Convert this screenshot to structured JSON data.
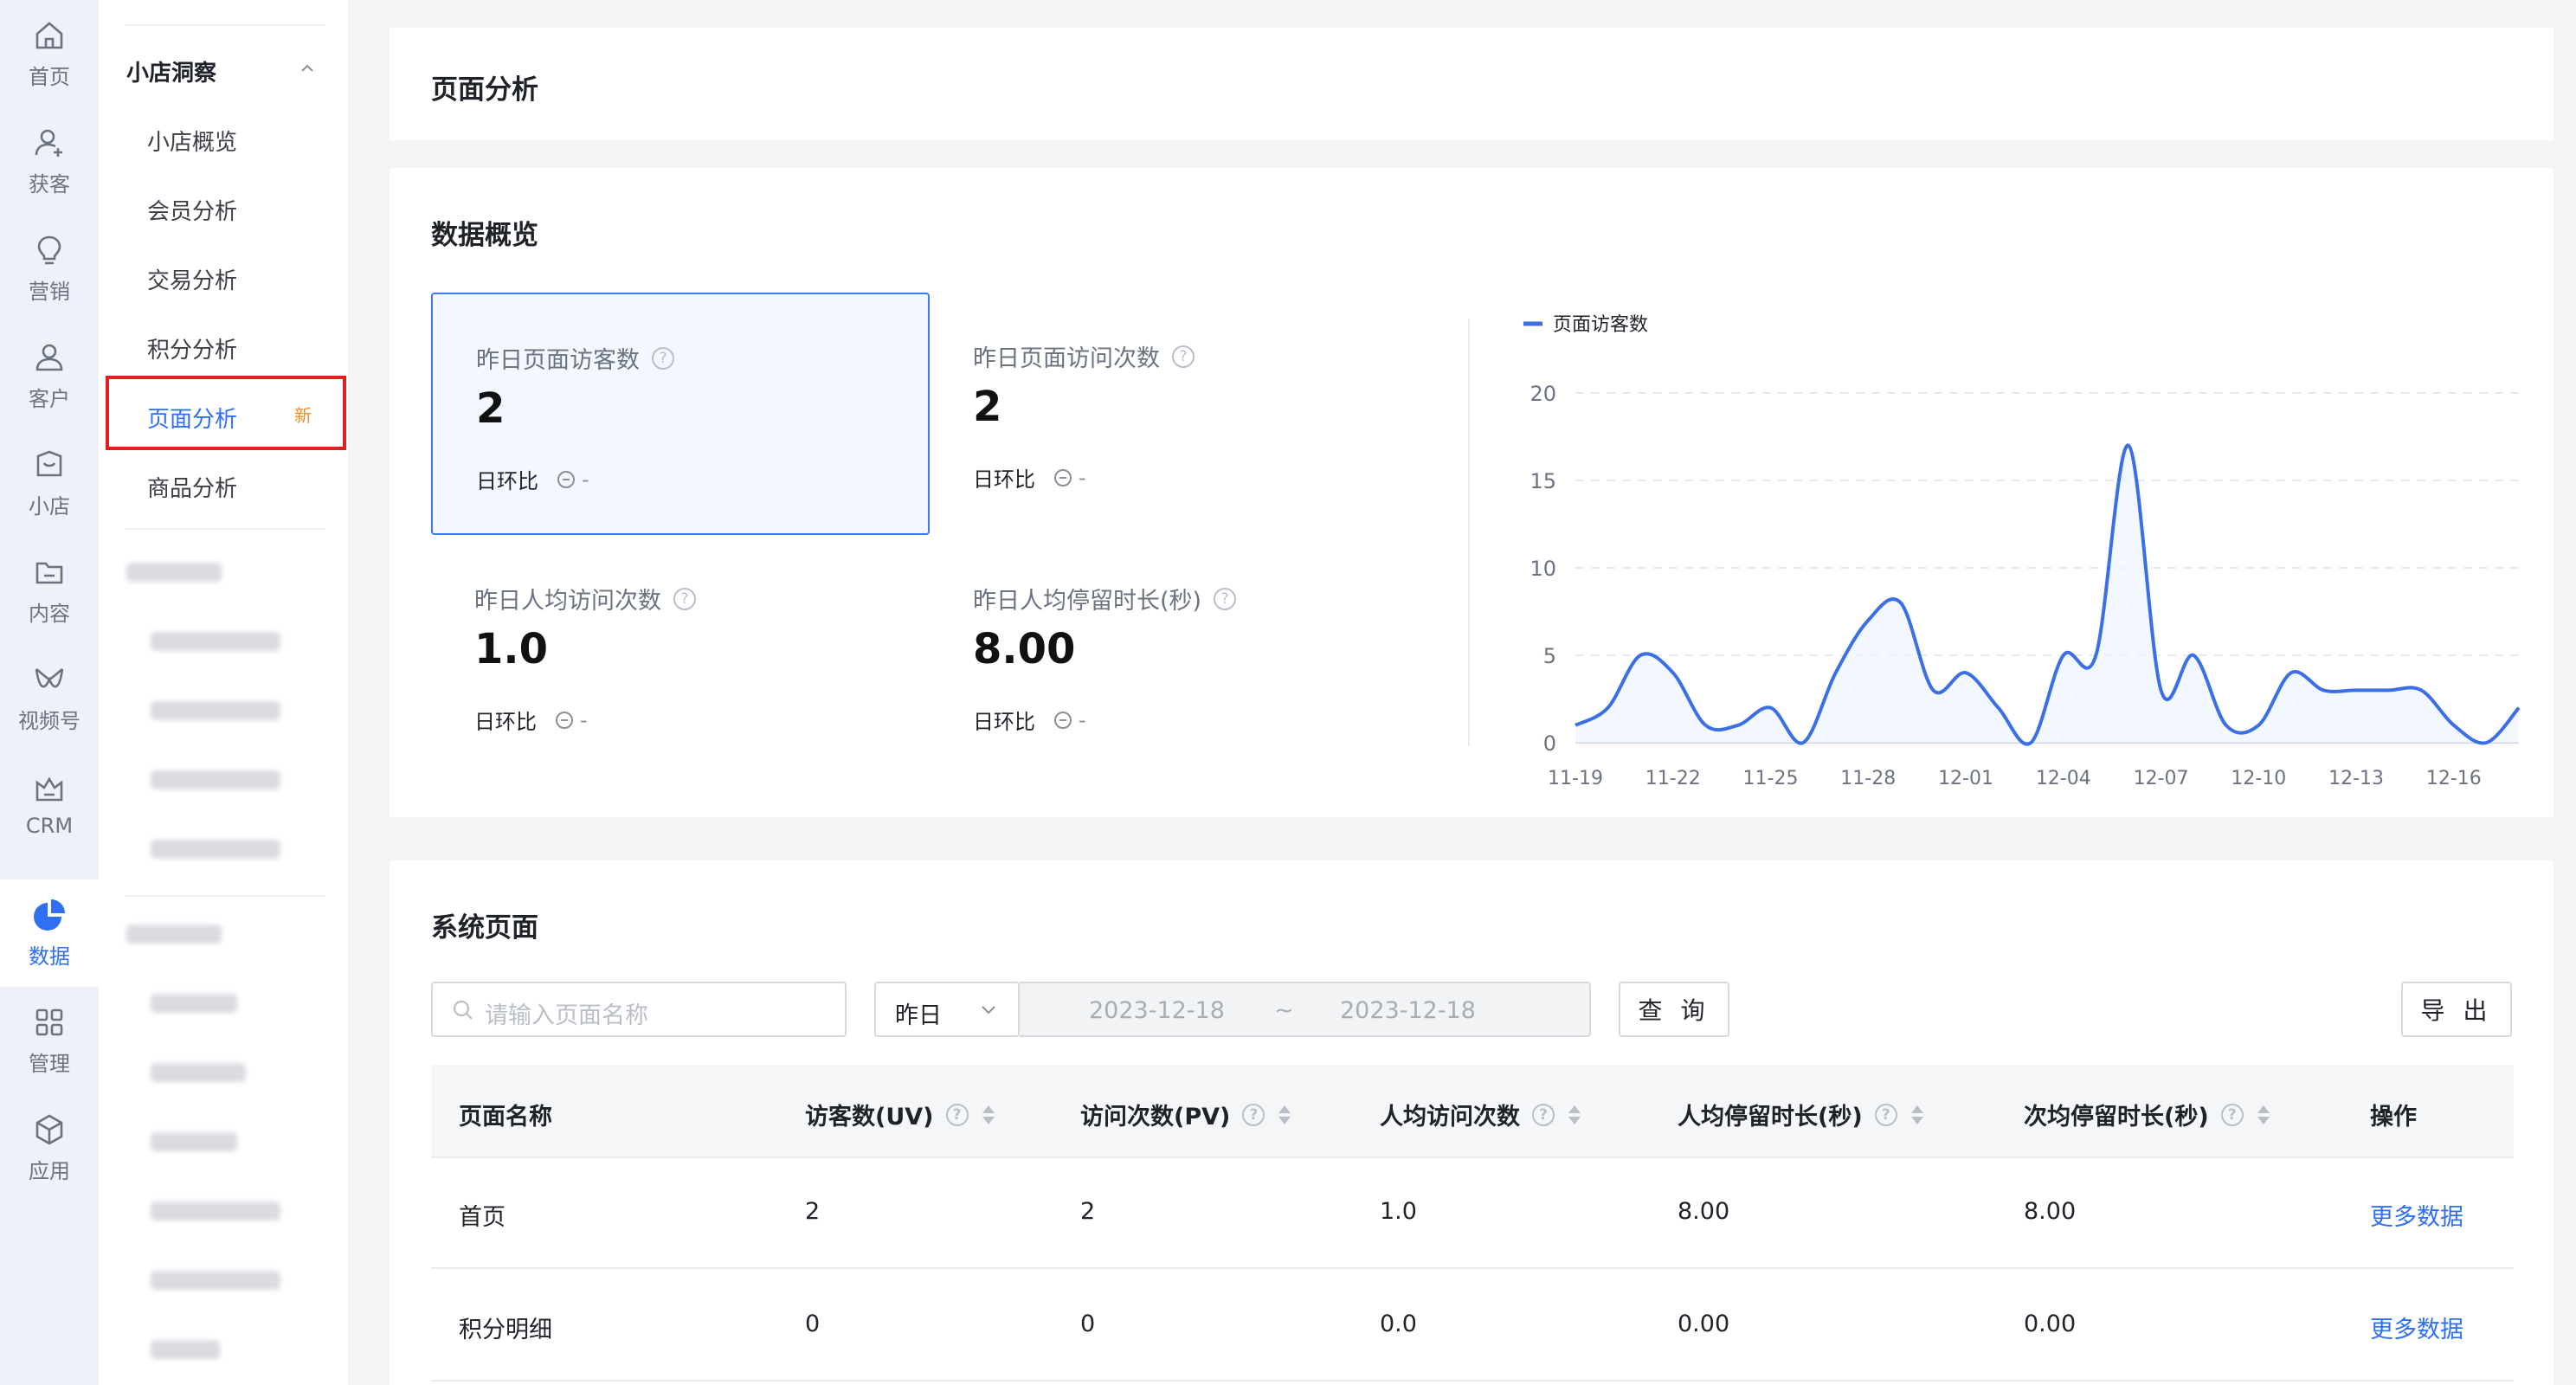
{
  "rail": {
    "items": [
      {
        "label": "首页",
        "icon": "home-icon"
      },
      {
        "label": "获客",
        "icon": "user-add-icon"
      },
      {
        "label": "营销",
        "icon": "bulb-icon"
      },
      {
        "label": "客户",
        "icon": "user-icon"
      },
      {
        "label": "小店",
        "icon": "shop-icon"
      },
      {
        "label": "内容",
        "icon": "folder-icon"
      },
      {
        "label": "视频号",
        "icon": "video-channel-icon"
      },
      {
        "label": "CRM",
        "icon": "crm-icon"
      },
      {
        "label": "数据",
        "icon": "pie-chart-icon"
      },
      {
        "label": "管理",
        "icon": "grid-icon"
      },
      {
        "label": "应用",
        "icon": "cube-icon"
      }
    ],
    "active_index": 8,
    "active_color": "#2f6ff2"
  },
  "menu": {
    "group_title": "小店洞察",
    "items": [
      "小店概览",
      "会员分析",
      "交易分析",
      "积分分析",
      "页面分析",
      "商品分析"
    ],
    "active_item": "页面分析",
    "new_badge": "新",
    "highlight_color": "#e02020"
  },
  "page": {
    "title": "页面分析"
  },
  "overview": {
    "title": "数据概览",
    "stats": [
      {
        "label": "昨日页面访客数",
        "value": "2",
        "compare_label": "日环比",
        "compare_value": "-"
      },
      {
        "label": "昨日页面访问次数",
        "value": "2",
        "compare_label": "日环比",
        "compare_value": "-"
      },
      {
        "label": "昨日人均访问次数",
        "value": "1.0",
        "compare_label": "日环比",
        "compare_value": "-"
      },
      {
        "label": "昨日人均停留时长(秒)",
        "value": "8.00",
        "compare_label": "日环比",
        "compare_value": "-"
      }
    ],
    "help_glyph": "?"
  },
  "chart_data": {
    "type": "line",
    "legend": [
      "页面访客数"
    ],
    "legend_position": "top-left",
    "x": [
      "11-19",
      "11-20",
      "11-21",
      "11-22",
      "11-23",
      "11-24",
      "11-25",
      "11-26",
      "11-27",
      "11-28",
      "11-29",
      "11-30",
      "12-01",
      "12-02",
      "12-03",
      "12-04",
      "12-05",
      "12-06",
      "12-07",
      "12-08",
      "12-09",
      "12-10",
      "12-11",
      "12-12",
      "12-13",
      "12-14",
      "12-15",
      "12-16",
      "12-17",
      "12-18"
    ],
    "x_tick_labels": [
      "11-19",
      "11-22",
      "11-25",
      "11-28",
      "12-01",
      "12-04",
      "12-07",
      "12-10",
      "12-13",
      "12-16"
    ],
    "series": [
      {
        "name": "页面访客数",
        "color": "#3b6fe6",
        "values": [
          1,
          2,
          5,
          4,
          1,
          1,
          2,
          0,
          4,
          7,
          8,
          3,
          4,
          2,
          0,
          5,
          5,
          17,
          3,
          5,
          1,
          1,
          4,
          3,
          3,
          3,
          3,
          1,
          0,
          2
        ]
      }
    ],
    "ylim": [
      0,
      20
    ],
    "y_ticks": [
      0,
      5,
      10,
      15,
      20
    ],
    "grid": true,
    "title": "",
    "xlabel": "",
    "ylabel": ""
  },
  "system_pages": {
    "title": "系统页面",
    "search_placeholder": "请输入页面名称",
    "date_select": "昨日",
    "date_start": "2023-12-18",
    "date_sep": "~",
    "date_end": "2023-12-18",
    "query_button": "查 询",
    "export_button": "导 出",
    "columns": [
      "页面名称",
      "访客数(UV)",
      "访问次数(PV)",
      "人均访问次数",
      "人均停留时长(秒)",
      "次均停留时长(秒)",
      "操作"
    ],
    "rows": [
      {
        "name": "首页",
        "uv": "2",
        "pv": "2",
        "avg_visits": "1.0",
        "avg_stay": "8.00",
        "per_visit_stay": "8.00",
        "action": "更多数据"
      },
      {
        "name": "积分明细",
        "uv": "0",
        "pv": "0",
        "avg_visits": "0.0",
        "avg_stay": "0.00",
        "per_visit_stay": "0.00",
        "action": "更多数据"
      }
    ]
  }
}
